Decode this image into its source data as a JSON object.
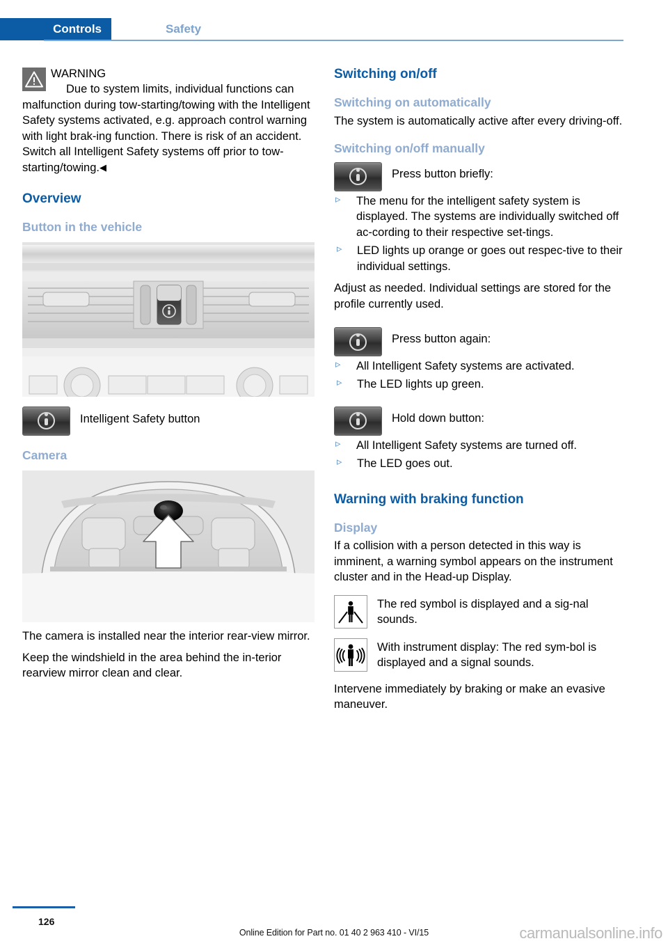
{
  "header": {
    "tab_active": "Controls",
    "tab_secondary": "Safety",
    "accent_color": "#0b5ca5",
    "muted_blue": "#8fabd0"
  },
  "left_column": {
    "warning": {
      "icon": "warning-triangle-icon",
      "title": "WARNING",
      "paragraph": "Due to system limits, individual functions can malfunction during tow-starting/towing with the Intelligent Safety systems activated, e.g. approach control warning with light brak-ing function. There is risk of an accident. Switch all Intelligent Safety systems off prior to tow-starting/towing.",
      "end_marker": "◀"
    },
    "overview_heading": "Overview",
    "button_heading": "Button in the vehicle",
    "dashboard_figure_alt": "Center console with Intelligent Safety button",
    "button_caption": "Intelligent Safety button",
    "camera_heading": "Camera",
    "camera_figure_alt": "Windshield interior with camera near rearview mirror",
    "camera_text_1": "The camera is installed near the interior rear-view mirror.",
    "camera_text_2": "Keep the windshield in the area behind the in-terior rearview mirror clean and clear."
  },
  "right_column": {
    "switching_heading": "Switching on/off",
    "auto_heading": "Switching on automatically",
    "auto_text": "The system is automatically active after every driving-off.",
    "manual_heading": "Switching on/off manually",
    "step_press_brief": {
      "lead": "Press button briefly:",
      "bullets": [
        "The menu for the intelligent safety system is displayed. The systems are individually switched off ac-cording to their respective set-tings."
      ]
    },
    "bullet_led_orange": "LED lights up orange or goes out respec-tive to their individual settings.",
    "adjust_text": "Adjust as needed. Individual settings are stored for the profile currently used.",
    "step_press_again": {
      "lead": "Press button again:",
      "bullets": [
        "All Intelligent Safety systems are activated."
      ]
    },
    "bullet_led_green": "The LED lights up green.",
    "step_hold_down": {
      "lead": "Hold down button:",
      "bullets": [
        "All Intelligent Safety systems are turned off."
      ]
    },
    "bullet_led_out": "The LED goes out.",
    "braking_heading": "Warning with braking function",
    "display_heading": "Display",
    "display_text": "If a collision with a person detected in this way is imminent, a warning symbol appears on the instrument cluster and in the Head-up Display.",
    "symbol_1": {
      "icon": "pedestrian-warning-icon",
      "text": "The red symbol is displayed and a sig-nal sounds."
    },
    "symbol_2": {
      "icon": "pedestrian-sound-warning-icon",
      "text": "With instrument display: The red sym-bol is displayed and a signal sounds."
    },
    "closing_text": "Intervene immediately by braking or make an evasive maneuver."
  },
  "footer": {
    "page_number": "126",
    "edition": "Online Edition for Part no. 01 40 2 963 410 - VI/15",
    "watermark": "carmanualsonline.info"
  }
}
